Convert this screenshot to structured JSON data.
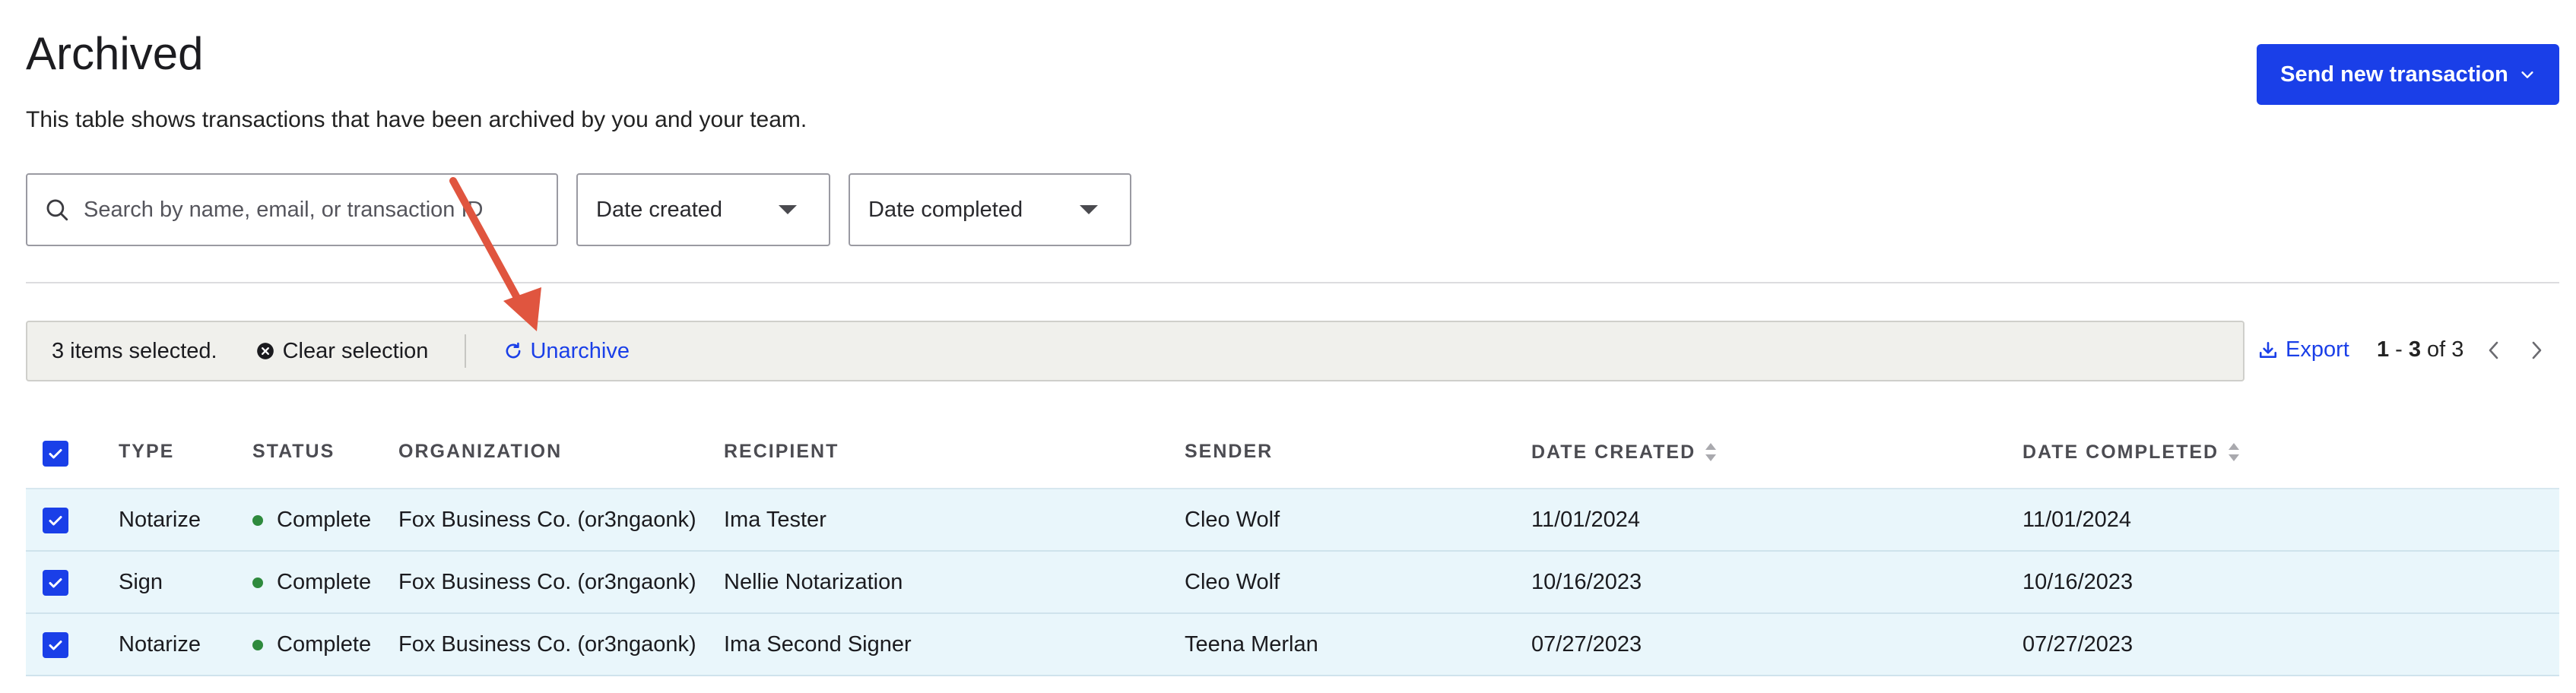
{
  "header": {
    "title": "Archived",
    "description": "This table shows transactions that have been archived by you and your team.",
    "send_button_label": "Send new transaction"
  },
  "filters": {
    "search_placeholder": "Search by name, email, or transaction ID",
    "date_created_label": "Date created",
    "date_completed_label": "Date completed"
  },
  "selection": {
    "count_label": "3 items selected.",
    "clear_label": "Clear selection",
    "unarchive_label": "Unarchive"
  },
  "toolbar": {
    "export_label": "Export",
    "page_start": "1",
    "page_sep": "-",
    "page_end": "3",
    "page_of": "of 3"
  },
  "table": {
    "columns": [
      "TYPE",
      "STATUS",
      "ORGANIZATION",
      "RECIPIENT",
      "SENDER",
      "DATE CREATED",
      "DATE COMPLETED"
    ],
    "rows": [
      {
        "type": "Notarize",
        "status": "Complete",
        "organization": "Fox Business Co. (or3ngaonk)",
        "recipient": "Ima Tester",
        "sender": "Cleo Wolf",
        "date_created": "11/01/2024",
        "date_completed": "11/01/2024",
        "selected": true
      },
      {
        "type": "Sign",
        "status": "Complete",
        "organization": "Fox Business Co. (or3ngaonk)",
        "recipient": "Nellie Notarization",
        "sender": "Cleo Wolf",
        "date_created": "10/16/2023",
        "date_completed": "10/16/2023",
        "selected": true
      },
      {
        "type": "Notarize",
        "status": "Complete",
        "organization": "Fox Business Co. (or3ngaonk)",
        "recipient": "Ima Second Signer",
        "sender": "Teena Merlan",
        "date_created": "07/27/2023",
        "date_completed": "07/27/2023",
        "selected": true
      }
    ]
  },
  "colors": {
    "accent": "#1a3fe8",
    "status_complete": "#2e8a3d",
    "row_selected_bg": "#e9f6fb",
    "annotation_arrow": "#e0553f"
  },
  "icons": {
    "search": "search-icon",
    "chevron": "chevron-down-icon",
    "clear": "close-circle-icon",
    "unarchive": "refresh-icon",
    "export": "download-icon",
    "prev": "chevron-left-icon",
    "next": "chevron-right-icon",
    "sort": "sort-icon",
    "checkbox": "checkbox-checked-icon"
  }
}
